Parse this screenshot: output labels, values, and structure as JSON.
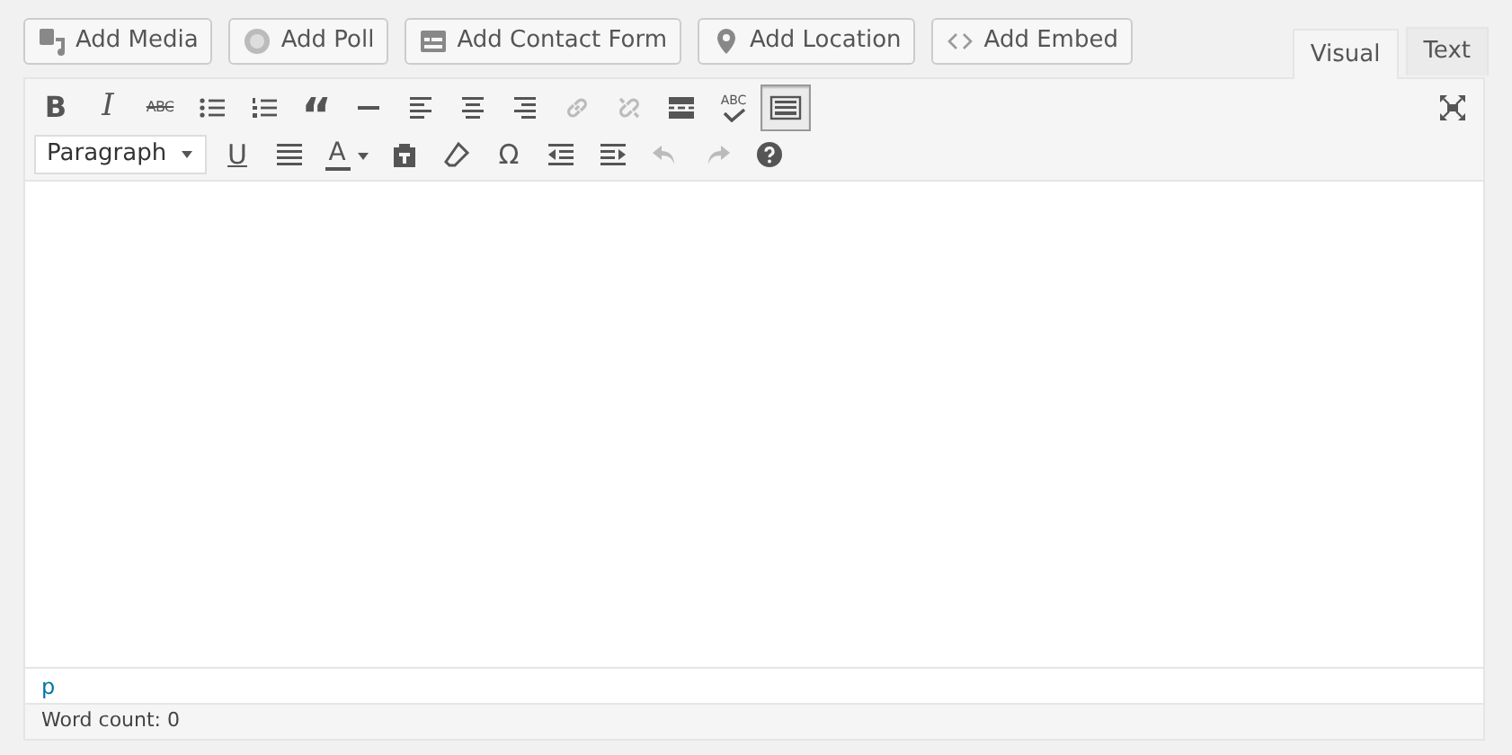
{
  "media_buttons": [
    {
      "label": "Add Media"
    },
    {
      "label": "Add Poll"
    },
    {
      "label": "Add Contact Form"
    },
    {
      "label": "Add Location"
    },
    {
      "label": "Add Embed"
    }
  ],
  "tabs": [
    {
      "label": "Visual",
      "selected": true
    },
    {
      "label": "Text",
      "selected": false
    }
  ],
  "toolbar_row_1": [
    {
      "kind": "glyph",
      "glyph": "B",
      "disabled": false,
      "pressed": false
    },
    {
      "kind": "glyph",
      "glyph": "I",
      "disabled": false,
      "pressed": false
    },
    {
      "kind": "strike",
      "glyph": "ABC",
      "disabled": false,
      "pressed": false
    },
    {
      "kind": "icon",
      "disabled": false,
      "pressed": false
    },
    {
      "kind": "icon",
      "disabled": false,
      "pressed": false
    },
    {
      "kind": "glyph",
      "glyph": "“",
      "disabled": false,
      "pressed": false
    },
    {
      "kind": "icon",
      "disabled": false,
      "pressed": false
    },
    {
      "kind": "icon",
      "disabled": false,
      "pressed": false
    },
    {
      "kind": "icon",
      "disabled": false,
      "pressed": false
    },
    {
      "kind": "icon",
      "disabled": false,
      "pressed": false
    },
    {
      "kind": "icon",
      "disabled": true,
      "pressed": false
    },
    {
      "kind": "icon",
      "disabled": true,
      "pressed": false
    },
    {
      "kind": "icon",
      "disabled": false,
      "pressed": false
    },
    {
      "kind": "check",
      "glyph": "ABC",
      "disabled": false,
      "pressed": false
    }
  ],
  "toolbar_toggle": {
    "pressed": true
  },
  "format_select": {
    "value": "Paragraph"
  },
  "toolbar_row_2": [
    {
      "kind": "glyph",
      "glyph": "U",
      "disabled": false,
      "pressed": false
    },
    {
      "kind": "icon",
      "disabled": false,
      "pressed": false
    },
    {
      "kind": "color",
      "glyph": "A",
      "disabled": false,
      "pressed": false
    },
    {
      "kind": "icon",
      "disabled": false,
      "pressed": false
    },
    {
      "kind": "icon",
      "disabled": false,
      "pressed": false
    },
    {
      "kind": "glyph",
      "glyph": "Ω",
      "disabled": false,
      "pressed": false
    },
    {
      "kind": "icon",
      "disabled": false,
      "pressed": false
    },
    {
      "kind": "icon",
      "disabled": false,
      "pressed": false
    },
    {
      "kind": "icon",
      "disabled": true,
      "pressed": false
    },
    {
      "kind": "icon",
      "disabled": true,
      "pressed": false
    },
    {
      "kind": "icon",
      "disabled": false,
      "pressed": false
    }
  ],
  "element_path": "p",
  "word_count": "Word count: 0"
}
